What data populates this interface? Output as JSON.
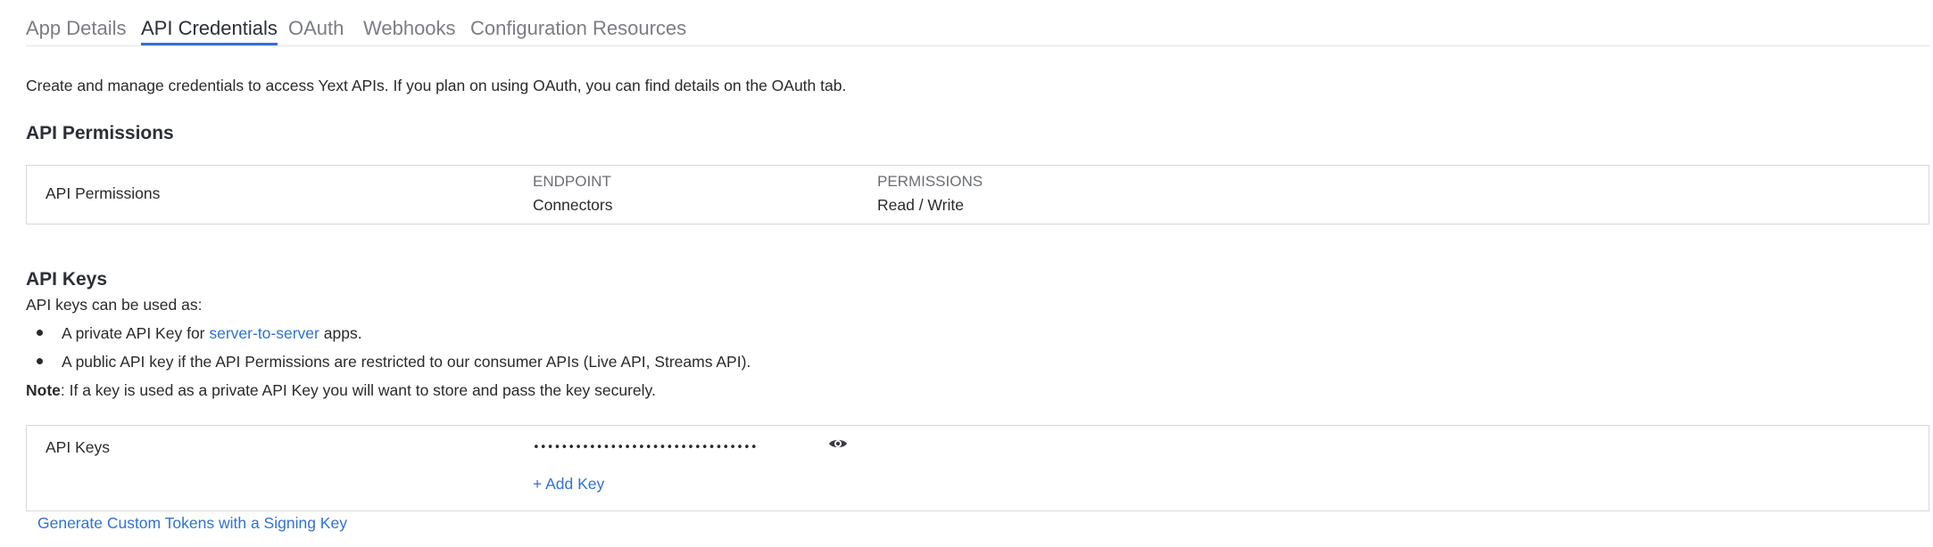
{
  "tabs": [
    {
      "label": "App Details",
      "active": false
    },
    {
      "label": "API Credentials",
      "active": true
    },
    {
      "label": "OAuth",
      "active": false
    },
    {
      "label": "Webhooks",
      "active": false
    },
    {
      "label": "Configuration Resources",
      "active": false
    }
  ],
  "intro": "Create and manage credentials to access Yext APIs. If you plan on using OAuth, you can find details on the OAuth tab.",
  "permissions": {
    "title": "API Permissions",
    "row_label": "API Permissions",
    "endpoint_header": "ENDPOINT",
    "endpoint_value": "Connectors",
    "permissions_header": "PERMISSIONS",
    "permissions_value": "Read / Write"
  },
  "api_keys": {
    "title": "API Keys",
    "subtitle": "API keys can be used as:",
    "bullet1_prefix": "A private API Key for",
    "bullet1_link": "server-to-server",
    "bullet1_suffix": "apps.",
    "bullet2": "A public API key if the API Permissions are restricted to our consumer APIs (Live API, Streams API).",
    "note_bold": "Note",
    "note_text": ": If a key is used as a private API Key you will want to store and pass the key securely.",
    "row_label": "API Keys",
    "masked_key": "••••••••••••••••••••••••••••••••",
    "add_key": "+ Add Key",
    "custom_tokens_link": "Generate Custom Tokens with a Signing Key"
  },
  "colors": {
    "accent": "#2f72d4",
    "tab_inactive": "#7a7d83",
    "border": "#d7d7d7"
  },
  "icons": {
    "reveal": "eye-icon"
  }
}
